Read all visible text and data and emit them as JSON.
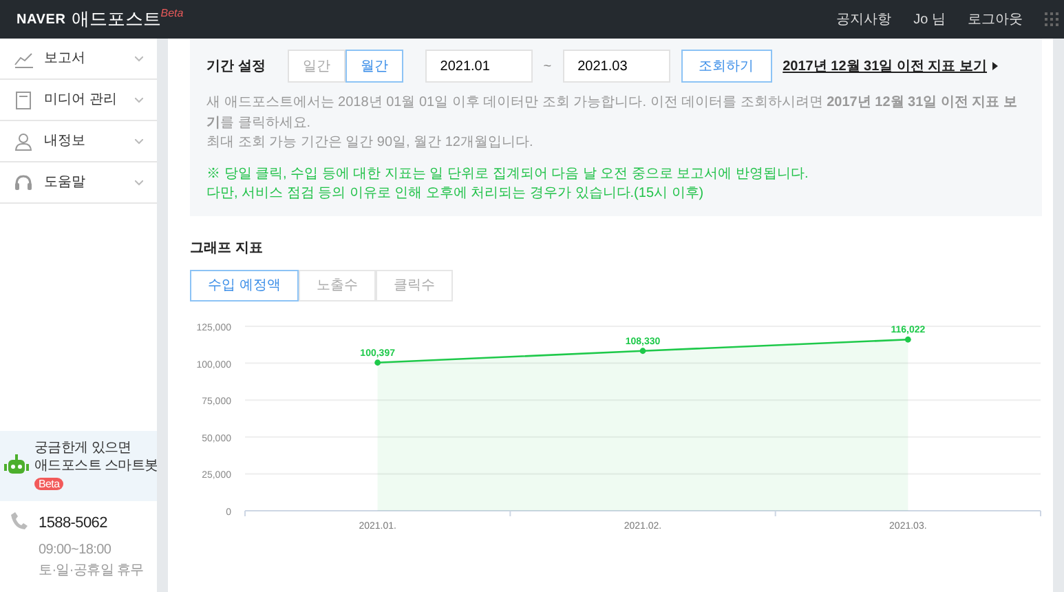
{
  "header": {
    "brand": "NAVER",
    "title": "애드포스트",
    "badge": "Beta",
    "links": [
      "공지사항",
      "Jo 님",
      "로그아웃"
    ]
  },
  "sidebar": {
    "items": [
      {
        "label": "보고서",
        "kind": "chart"
      },
      {
        "label": "미디어 관리",
        "kind": "document"
      },
      {
        "label": "내정보",
        "kind": "person"
      },
      {
        "label": "도움말",
        "kind": "headset"
      }
    ]
  },
  "chatbot": {
    "line1": "궁금한게 있으면",
    "line2": "애드포스트 스마트봇",
    "badge": "Beta"
  },
  "contact": {
    "phone": "1588-5062",
    "hours": "09:00~18:00",
    "closed": "토·일·공휴일 휴무"
  },
  "filter": {
    "label": "기간 설정",
    "period_tabs": [
      {
        "label": "일간",
        "selected": false
      },
      {
        "label": "월간",
        "selected": true
      }
    ],
    "start": "2021.01",
    "separator": "~",
    "end": "2021.03",
    "search_button": "조회하기",
    "legacy_link": "2017년 12월 31일 이전 지표 보기",
    "notes": [
      "새 애드포스트에서는 2018년 01월 01일 이후 데이터만 조회 가능합니다. 이전 데이터를 조회하시려면 **2017년 12월 31일 이전 지표 보기**를 클릭하세요.",
      "최대 조회 가능 기간은 일간 90일, 월간 12개월입니다."
    ],
    "alerts": [
      "※ 당일 클릭, 수입 등에 대한 지표는 일 단위로 집계되어 다음 날 오전 중으로 보고서에 반영됩니다.",
      "다만, 서비스 점검 등의 이유로 인해 오후에 처리되는 경우가 있습니다.(15시 이후)"
    ]
  },
  "graph": {
    "title": "그래프 지표",
    "tabs": [
      {
        "label": "수입 예정액",
        "selected": true
      },
      {
        "label": "노출수",
        "selected": false
      },
      {
        "label": "클릭수",
        "selected": false
      }
    ],
    "chart_data": {
      "type": "area",
      "categories": [
        "2021.01.",
        "2021.02.",
        "2021.03."
      ],
      "series": [
        {
          "color": "#1ec94a",
          "values": [
            100397,
            108330,
            116022
          ]
        }
      ],
      "ylim": [
        0,
        125000
      ],
      "yticks": [
        0,
        {
          "value": 25000,
          "label": "25,000"
        },
        {
          "value": 50000,
          "label": "50,000"
        },
        {
          "value": 75000,
          "label": "75,000"
        },
        {
          "value": 100000,
          "label": "100,000"
        },
        {
          "value": 125000,
          "label": "125,000"
        }
      ],
      "grid": true,
      "value_labels": [
        "100,397",
        "108,330",
        "116,022"
      ]
    }
  }
}
